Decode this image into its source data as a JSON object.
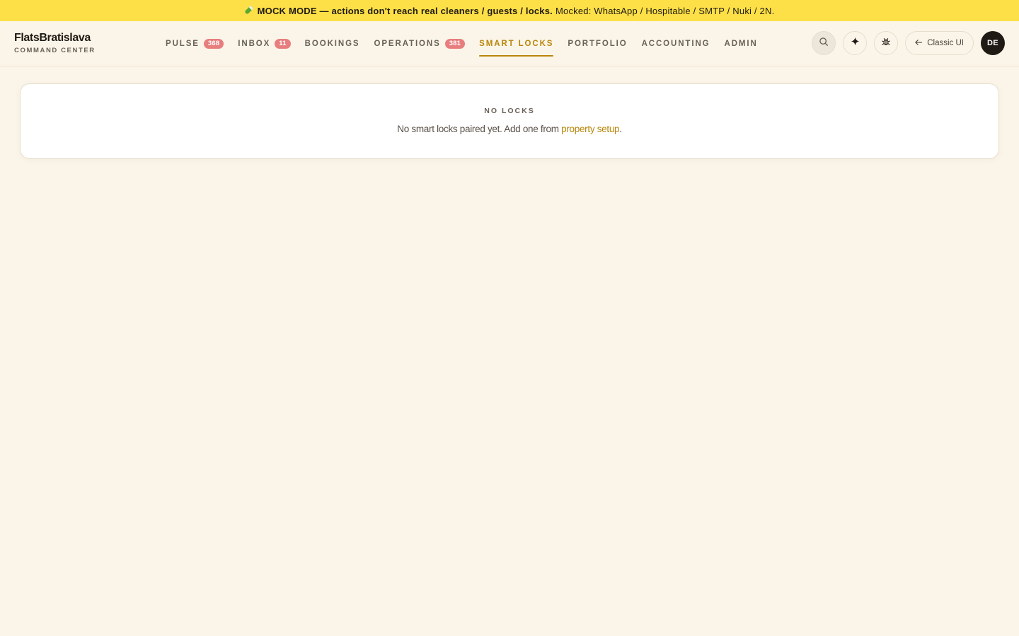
{
  "banner": {
    "icon": "test-tube-icon",
    "strong_text": "MOCK MODE — actions don't reach real cleaners / guests / locks.",
    "rest_text": "Mocked: WhatsApp / Hospitable / SMTP / Nuki / 2N."
  },
  "brand": {
    "title": "FlatsBratislava",
    "subtitle": "COMMAND CENTER"
  },
  "nav": {
    "items": [
      {
        "label": "PULSE",
        "badge": "368",
        "active": false
      },
      {
        "label": "INBOX",
        "badge": "11",
        "active": false
      },
      {
        "label": "BOOKINGS",
        "badge": "",
        "active": false
      },
      {
        "label": "OPERATIONS",
        "badge": "381",
        "active": false
      },
      {
        "label": "SMART LOCKS",
        "badge": "",
        "active": true
      },
      {
        "label": "PORTFOLIO",
        "badge": "",
        "active": false
      },
      {
        "label": "ACCOUNTING",
        "badge": "",
        "active": false
      },
      {
        "label": "ADMIN",
        "badge": "",
        "active": false
      }
    ]
  },
  "actions": {
    "search_icon": "search-icon",
    "sparkle_icon": "sparkle-icon",
    "bug_icon": "bug-icon",
    "classic_label": "Classic UI",
    "classic_icon": "arrow-left-icon",
    "avatar_initials": "DE"
  },
  "empty_state": {
    "title": "NO LOCKS",
    "text_before": "No smart locks paired yet. Add one from ",
    "link_text": "property setup",
    "text_after": "."
  },
  "colors": {
    "background": "#fbf5e9",
    "banner": "#fde047",
    "accent": "#b8860b",
    "badge": "#e87d7d",
    "avatar": "#1f1a14"
  }
}
